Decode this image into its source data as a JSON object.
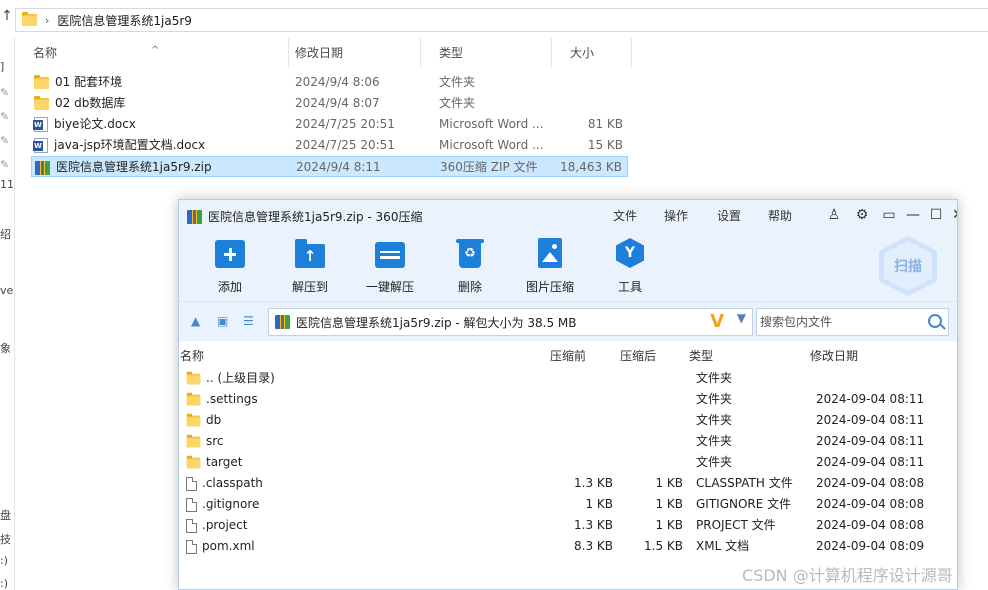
{
  "explorer": {
    "breadcrumb": "医院信息管理系统1ja5r9",
    "nav_strip_fragments": [
      "]",
      "11",
      "绍",
      "ve",
      "象",
      "盘",
      "技",
      ":)",
      ":)"
    ],
    "columns": {
      "name": "名称",
      "date": "修改日期",
      "type": "类型",
      "size": "大小"
    },
    "files": [
      {
        "name": "01 配套环境",
        "date": "2024/9/4 8:06",
        "type": "文件夹",
        "size": "",
        "icon": "folder-icon",
        "selected": false
      },
      {
        "name": "02 db数据库",
        "date": "2024/9/4 8:07",
        "type": "文件夹",
        "size": "",
        "icon": "folder-icon",
        "selected": false
      },
      {
        "name": "biye论文.docx",
        "date": "2024/7/25 20:51",
        "type": "Microsoft Word ...",
        "size": "81 KB",
        "icon": "word-doc-icon",
        "selected": false
      },
      {
        "name": "java-jsp环境配置文档.docx",
        "date": "2024/7/25 20:51",
        "type": "Microsoft Word ...",
        "size": "15 KB",
        "icon": "word-doc-icon",
        "selected": false
      },
      {
        "name": "医院信息管理系统1ja5r9.zip",
        "date": "2024/9/4 8:11",
        "type": "360压缩 ZIP 文件",
        "size": "18,463 KB",
        "icon": "zip-archive-icon",
        "selected": true
      }
    ]
  },
  "zip": {
    "title": "医院信息管理系统1ja5r9.zip - 360压缩",
    "menu": [
      "文件",
      "操作",
      "设置",
      "帮助"
    ],
    "toolbar": [
      "添加",
      "解压到",
      "一键解压",
      "删除",
      "图片压缩",
      "工具"
    ],
    "scan_label": "扫描",
    "path_text": "医院信息管理系统1ja5r9.zip - 解包大小为 38.5 MB",
    "search_placeholder": "搜索包内文件",
    "columns": {
      "name": "名称",
      "compressed": "压缩前",
      "original": "压缩后",
      "type": "类型",
      "date": "修改日期"
    },
    "rows": [
      {
        "name": ".. (上级目录)",
        "before": "",
        "after": "",
        "type": "文件夹",
        "date": "",
        "icon": "folder-icon"
      },
      {
        "name": ".settings",
        "before": "",
        "after": "",
        "type": "文件夹",
        "date": "2024-09-04 08:11",
        "icon": "folder-icon"
      },
      {
        "name": "db",
        "before": "",
        "after": "",
        "type": "文件夹",
        "date": "2024-09-04 08:11",
        "icon": "folder-icon"
      },
      {
        "name": "src",
        "before": "",
        "after": "",
        "type": "文件夹",
        "date": "2024-09-04 08:11",
        "icon": "folder-icon"
      },
      {
        "name": "target",
        "before": "",
        "after": "",
        "type": "文件夹",
        "date": "2024-09-04 08:11",
        "icon": "folder-icon"
      },
      {
        "name": ".classpath",
        "before": "1.3 KB",
        "after": "1 KB",
        "type": "CLASSPATH 文件",
        "date": "2024-09-04 08:08",
        "icon": "file-icon"
      },
      {
        "name": ".gitignore",
        "before": "1 KB",
        "after": "1 KB",
        "type": "GITIGNORE 文件",
        "date": "2024-09-04 08:08",
        "icon": "file-icon"
      },
      {
        "name": ".project",
        "before": "1.3 KB",
        "after": "1 KB",
        "type": "PROJECT 文件",
        "date": "2024-09-04 08:08",
        "icon": "file-icon"
      },
      {
        "name": "pom.xml",
        "before": "8.3 KB",
        "after": "1.5 KB",
        "type": "XML 文档",
        "date": "2024-09-04 08:09",
        "icon": "file-icon"
      }
    ]
  },
  "watermark": "CSDN @计算机程序设计源哥",
  "colors": {
    "accent": "#1c7fd9",
    "selection": "#cce8ff",
    "toolbar_bg": "#e9f2fd"
  }
}
